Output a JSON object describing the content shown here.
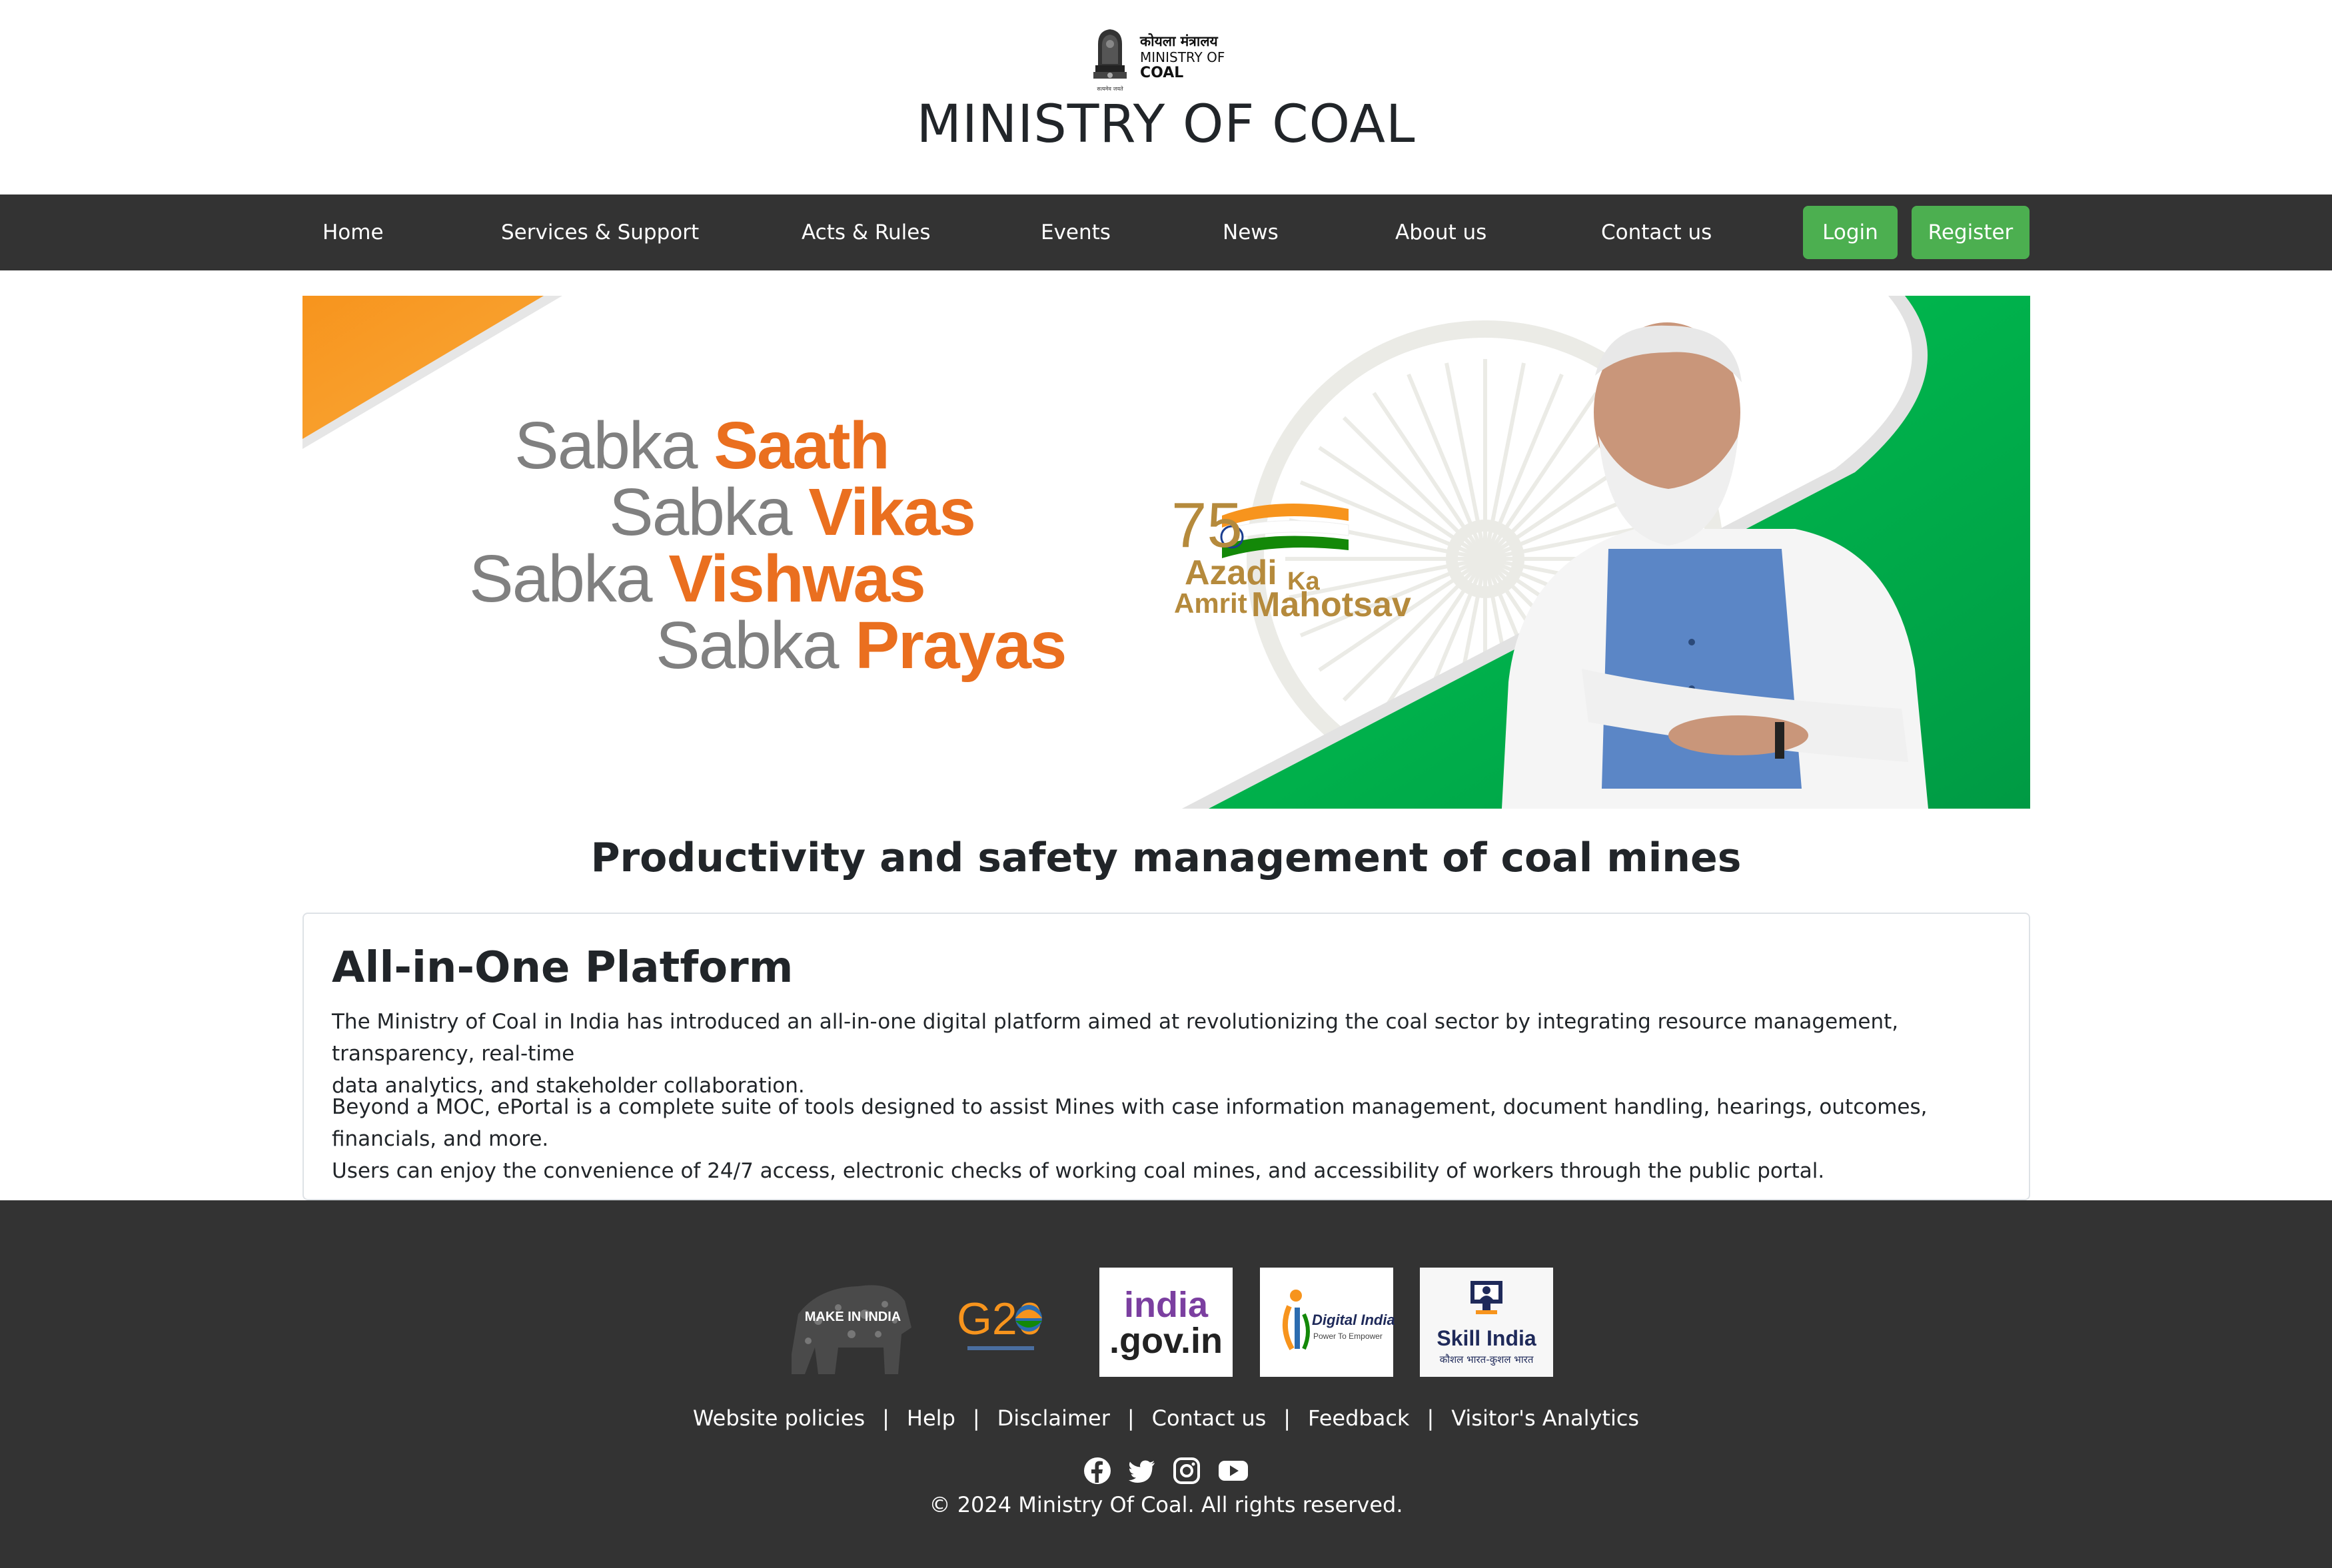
{
  "header": {
    "emblem_text_hindi": "कोयला मंत्रालय",
    "emblem_text_line1": "MINISTRY OF",
    "emblem_text_line2": "COAL",
    "emblem_caption": "सत्यमेव जयते",
    "site_title": "MINISTRY OF COAL"
  },
  "nav": {
    "items": [
      {
        "label": "Home"
      },
      {
        "label": "Services & Support"
      },
      {
        "label": "Acts & Rules"
      },
      {
        "label": "Events"
      },
      {
        "label": "News"
      },
      {
        "label": "About us"
      },
      {
        "label": "Contact us"
      }
    ],
    "login_label": "Login",
    "register_label": "Register",
    "accent_color": "#4caf50",
    "background_color": "#333333"
  },
  "banner": {
    "lines": [
      {
        "prefix": "Sabka",
        "emphasis": "Saath"
      },
      {
        "prefix": "Sabka",
        "emphasis": "Vikas"
      },
      {
        "prefix": "Sabka",
        "emphasis": "Vishwas"
      },
      {
        "prefix": "Sabka",
        "emphasis": "Prayas"
      }
    ],
    "logo_number": "75",
    "logo_line1": "Azadi",
    "logo_line1_small": "Ka",
    "logo_line2": "Amrit",
    "logo_line2_big": "Mahotsav",
    "colors": {
      "saffron": "#f7941d",
      "green": "#00b050",
      "emphasis": "#ea6f1f",
      "grey_text": "#808080"
    }
  },
  "section": {
    "title": "Productivity and safety management of coal mines"
  },
  "card": {
    "title": "All-in-One Platform",
    "paragraph1_line1": "The Ministry of Coal in India has introduced an all-in-one digital platform aimed at revolutionizing the coal sector by integrating resource management, transparency, real-time",
    "paragraph1_line2": "data analytics, and stakeholder collaboration.",
    "paragraph2_line1": "Beyond a MOC, ePortal is a complete suite of tools designed to assist Mines with case information management, document handling, hearings, outcomes, financials, and more.",
    "paragraph2_line2": "Users can enjoy the convenience of 24/7 access, electronic checks of working coal mines, and accessibility of workers through the public portal."
  },
  "footer": {
    "logos": [
      {
        "name": "make-in-india",
        "text": "MAKE IN INDIA"
      },
      {
        "name": "g20",
        "text": "G20"
      },
      {
        "name": "india-gov",
        "text_line1": "india",
        "text_line2": ".gov.in"
      },
      {
        "name": "digital-india",
        "text_line1": "Digital India",
        "text_line2": "Power To Empower"
      },
      {
        "name": "skill-india",
        "text_line1": "Skill India",
        "text_line2": "कौशल भारत-कुशल भारत"
      }
    ],
    "links": [
      "Website policies",
      "Help",
      "Disclaimer",
      "Contact us",
      "Feedback",
      "Visitor's Analytics"
    ],
    "separator": "|",
    "social_icons": [
      "facebook-icon",
      "twitter-icon",
      "instagram-icon",
      "youtube-icon"
    ],
    "copyright": "© 2024 Ministry Of Coal. All rights reserved."
  }
}
